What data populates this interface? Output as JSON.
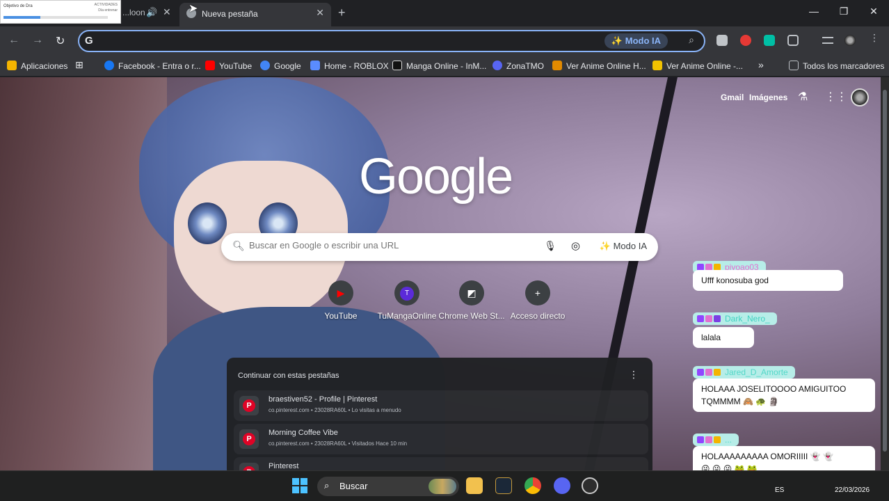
{
  "thumbnail": {
    "title": "Objetivo de Dra",
    "line_a": "ACTIVIDADES",
    "line_b": "Día entrenar"
  },
  "tabs": [
    {
      "title": "...loon",
      "active": false
    },
    {
      "title": "Nueva pestaña",
      "active": true
    }
  ],
  "toolbar": {
    "omnibox_g": "G",
    "modo_ia": "Modo IA"
  },
  "bookmarks": [
    {
      "label": "Aplicaciones",
      "icon": "apps-grid-icon",
      "color": "#f4b400"
    },
    {
      "label": "Facebook - Entra o r...",
      "icon": "facebook-icon",
      "color": "#1877f2"
    },
    {
      "label": "YouTube",
      "icon": "youtube-icon",
      "color": "#ff0000"
    },
    {
      "label": "Google",
      "icon": "google-icon",
      "color": "#4285f4"
    },
    {
      "label": "Home - ROBLOX",
      "icon": "roblox-icon",
      "color": "#5a8cff"
    },
    {
      "label": "Manga Online - InM...",
      "icon": "manga-icon",
      "color": "#111111"
    },
    {
      "label": "ZonaTMO",
      "icon": "zonatmo-icon",
      "color": "#5865f2"
    },
    {
      "label": "Ver Anime Online H...",
      "icon": "anime-icon",
      "color": "#e28a00"
    },
    {
      "label": "Ver Anime Online -...",
      "icon": "anime2-icon",
      "color": "#f2c200"
    }
  ],
  "bookmarks_all": "Todos los marcadores",
  "header_links": {
    "gmail": "Gmail",
    "images": "Imágenes"
  },
  "logo": "Google",
  "search": {
    "placeholder": "Buscar en Google o escribir una URL",
    "modo_ia": "Modo IA"
  },
  "shortcuts": [
    {
      "label": "YouTube",
      "glyph": "▶",
      "color": "#ff0000"
    },
    {
      "label": "TuMangaOnline",
      "glyph": "T",
      "color": "#5b2bd9"
    },
    {
      "label": "Chrome Web St...",
      "glyph": "◩",
      "color": "#e8eaed"
    },
    {
      "label": "Acceso directo",
      "glyph": "+",
      "color": "#3c4043"
    }
  ],
  "continue_tabs": {
    "heading": "Continuar con estas pestañas",
    "items": [
      {
        "title": "braestiven52 - Profile | Pinterest",
        "sub": "co.pinterest.com • 23028RA60L • Lo visitas a menudo"
      },
      {
        "title": "Morning Coffee Vibe",
        "sub": "co.pinterest.com • 23028RA60L • Visitados Hace 10 min"
      },
      {
        "title": "Pinterest",
        "sub": ""
      }
    ]
  },
  "chat": [
    {
      "user": "piyoao03",
      "user_color": "#e26fd0",
      "name_bg": "#b7ede8",
      "text": "Ufff konosuba god"
    },
    {
      "user": "Dark_Nero_",
      "user_color": "#3fd1c0",
      "name_bg": "#b7ede8",
      "text": "lalala"
    },
    {
      "user": "Jared_D_Amorte",
      "user_color": "#52d8c8",
      "name_bg": "#b7ede8",
      "text": "HOLAAA JOSELITOOOO AMIGUITOO",
      "text2": "TQMMMM 🙈 🐢 🗿"
    },
    {
      "user": "...",
      "user_color": "#52d8c8",
      "name_bg": "#b7ede8",
      "text": "HOLAAAAAAAAA OMORIIIII 👻 👻",
      "text2": "😜 😜 😜 🐸 🐸"
    }
  ],
  "taskbar": {
    "search": "Buscar",
    "lang": "ES",
    "date": "22/03/2026"
  }
}
